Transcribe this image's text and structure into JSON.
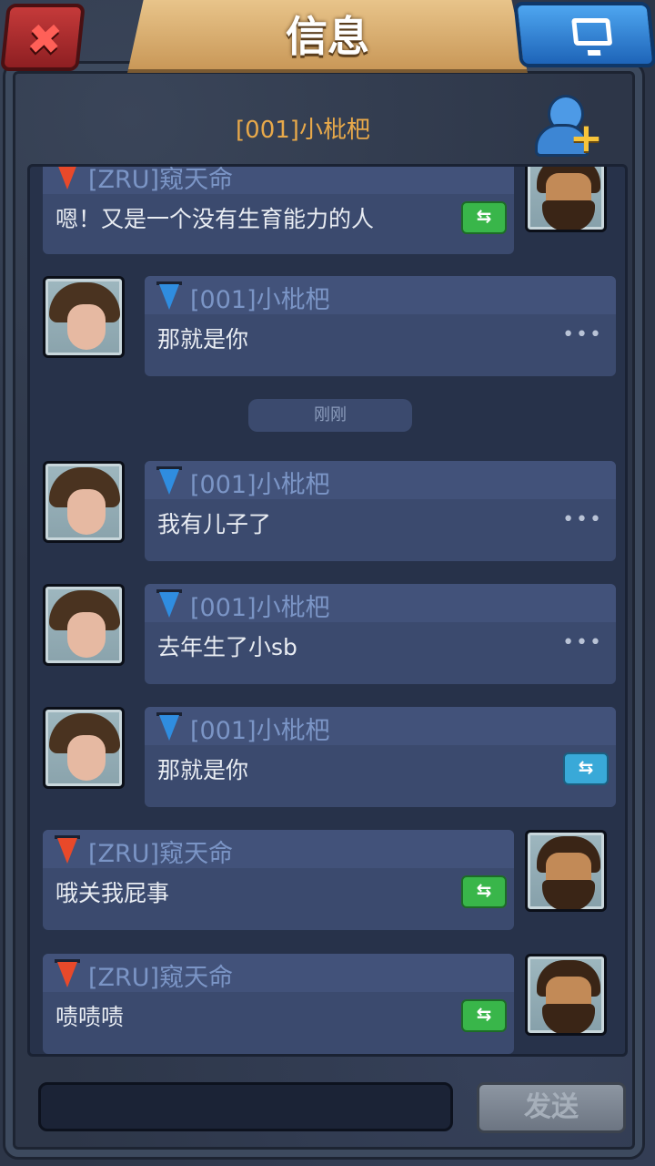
{
  "header": {
    "title": "信息",
    "close_icon": "close-icon",
    "screen_icon": "monitor-icon"
  },
  "chat": {
    "partner": "[001]小枇杷",
    "add_friend_icon": "add-friend-icon"
  },
  "messages": [
    {
      "side": "right",
      "sender": "[ZRU]窥天命",
      "text": "嗯！又是一个没有生育能力的人",
      "action": "translate-green"
    },
    {
      "side": "left",
      "sender": "[001]小枇杷",
      "text": "那就是你",
      "action": "dots"
    },
    {
      "side": "left",
      "sender": "[001]小枇杷",
      "text": "我有儿子了",
      "action": "dots"
    },
    {
      "side": "left",
      "sender": "[001]小枇杷",
      "text": "去年生了小sb",
      "action": "dots"
    },
    {
      "side": "left",
      "sender": "[001]小枇杷",
      "text": "那就是你",
      "action": "translate-blue"
    },
    {
      "side": "right",
      "sender": "[ZRU]窥天命",
      "text": "哦关我屁事",
      "action": "translate-green"
    },
    {
      "side": "right",
      "sender": "[ZRU]窥天命",
      "text": "啧啧啧",
      "action": "translate-green"
    }
  ],
  "timestamp": "刚刚",
  "composer": {
    "input_value": "",
    "send_label": "发送"
  },
  "colors": {
    "background": "#2a3344",
    "bubble": "#3b4a6e",
    "title_gold": "#e8a94a",
    "accent_green": "#39b64a",
    "accent_blue": "#39a9d8"
  }
}
